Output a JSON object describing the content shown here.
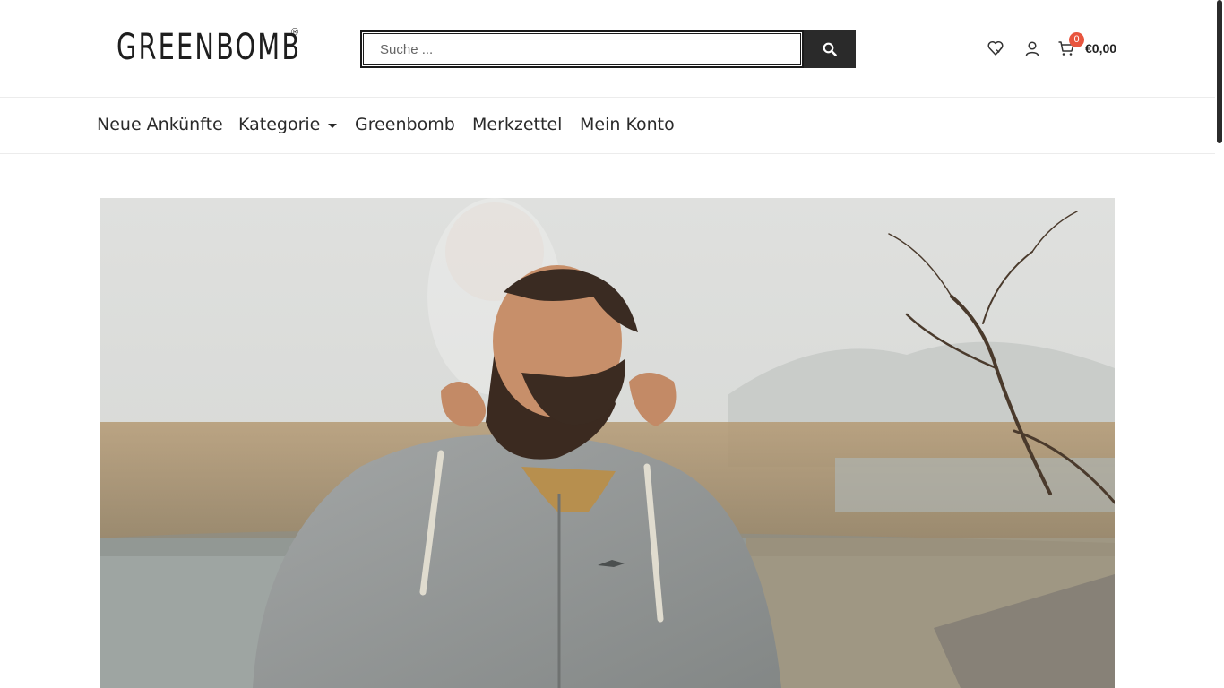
{
  "brand": {
    "name": "GREENBOMB",
    "reg_mark": "®"
  },
  "search": {
    "placeholder": "Suche ..."
  },
  "header_icons": {
    "wishlist": "heart-icon",
    "account": "user-icon",
    "cart": "cart-icon",
    "search": "search-icon"
  },
  "cart": {
    "count": "0",
    "total": "€0,00"
  },
  "nav": {
    "items": [
      {
        "label": "Neue Ankünfte"
      },
      {
        "label": "Kategorie",
        "has_dropdown": true
      },
      {
        "label": "Greenbomb"
      },
      {
        "label": "Merkzettel"
      },
      {
        "label": "Mein Konto"
      }
    ]
  },
  "colors": {
    "accent": "#e8553e",
    "button": "#2a2a2a",
    "text": "#222222"
  }
}
